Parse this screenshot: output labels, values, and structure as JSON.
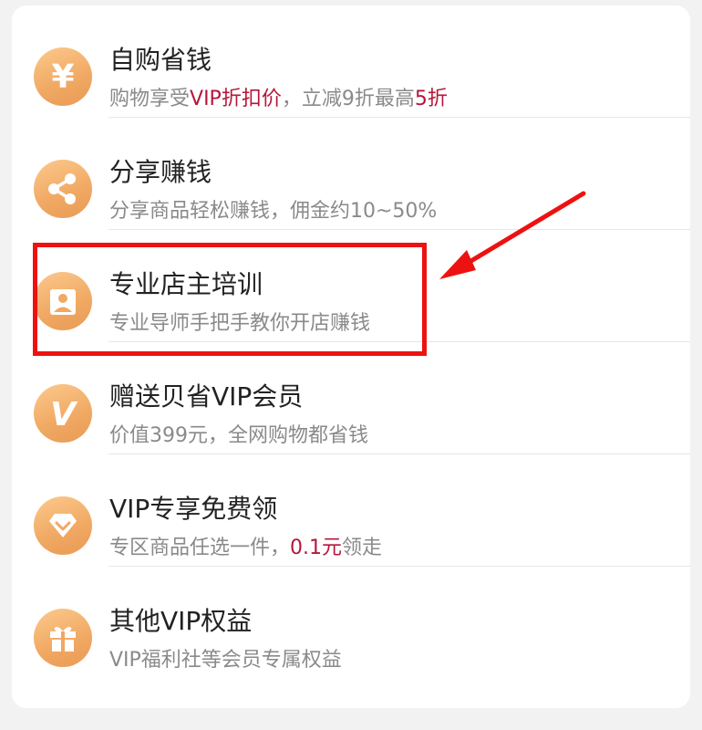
{
  "items": [
    {
      "title": "自购省钱",
      "subtitle_parts": [
        {
          "text": "购物享受",
          "highlight": false
        },
        {
          "text": "VIP折扣价",
          "highlight": true
        },
        {
          "text": "，立减9折最高",
          "highlight": false
        },
        {
          "text": "5折",
          "highlight": true
        }
      ],
      "icon": "yen-icon"
    },
    {
      "title": "分享赚钱",
      "subtitle_parts": [
        {
          "text": "分享商品轻松赚钱，佣金约10~50%",
          "highlight": false
        }
      ],
      "icon": "share-icon"
    },
    {
      "title": "专业店主培训",
      "subtitle_parts": [
        {
          "text": "专业导师手把手教你开店赚钱",
          "highlight": false
        }
      ],
      "icon": "person-icon"
    },
    {
      "title": "赠送贝省VIP会员",
      "subtitle_parts": [
        {
          "text": "价值399元，全网购物都省钱",
          "highlight": false
        }
      ],
      "icon": "vip-v-icon"
    },
    {
      "title": "VIP专享免费领",
      "subtitle_parts": [
        {
          "text": "专区商品任选一件，",
          "highlight": false
        },
        {
          "text": "0.1元",
          "highlight": true
        },
        {
          "text": "领走",
          "highlight": false
        }
      ],
      "icon": "diamond-icon"
    },
    {
      "title": "其他VIP权益",
      "subtitle_parts": [
        {
          "text": "VIP福利社等会员专属权益",
          "highlight": false
        }
      ],
      "icon": "gift-icon"
    }
  ],
  "colors": {
    "accent_text": "#b5173a",
    "icon_gradient_start": "#fcc98d",
    "icon_gradient_end": "#e99b55",
    "annotation_red": "#ee1111"
  }
}
